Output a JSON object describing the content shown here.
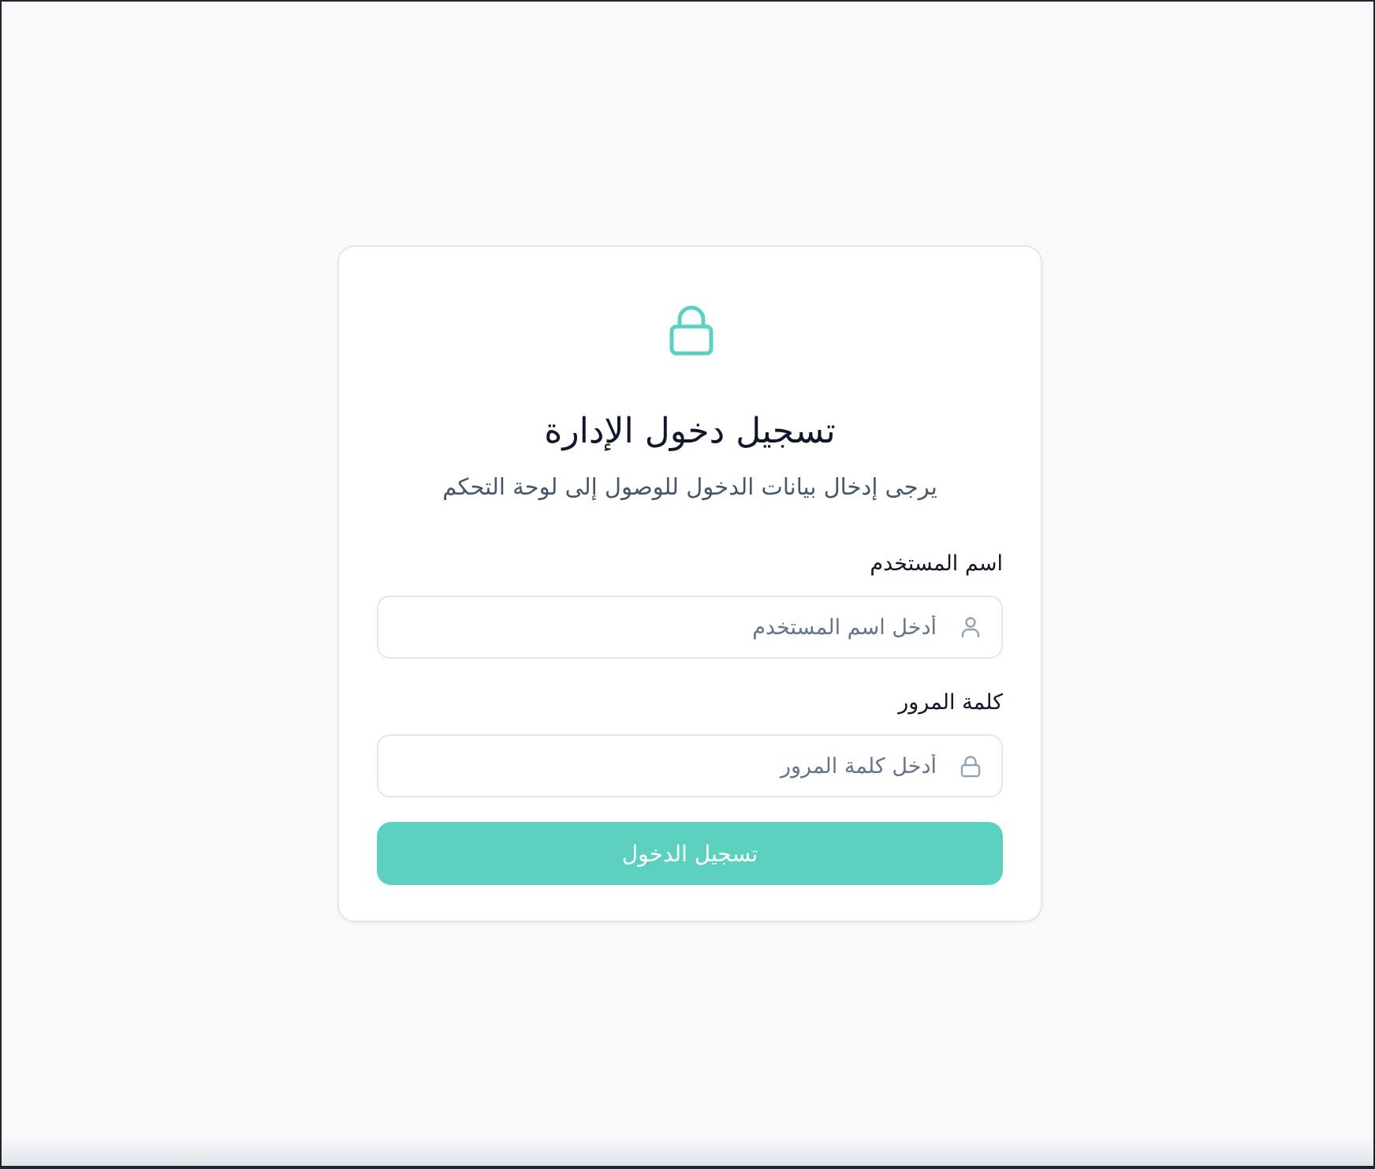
{
  "login": {
    "title": "تسجيل دخول الإدارة",
    "subtitle": "يرجى إدخال بيانات الدخول للوصول إلى لوحة التحكم",
    "username": {
      "label": "اسم المستخدم",
      "placeholder": "أدخل اسم المستخدم",
      "value": ""
    },
    "password": {
      "label": "كلمة المرور",
      "placeholder": "أدخل كلمة المرور",
      "value": ""
    },
    "submit_label": "تسجيل الدخول"
  },
  "icons": {
    "hero": "lock-icon",
    "username": "user-icon",
    "password": "lock-icon"
  },
  "colors": {
    "accent": "#5dd1c0",
    "page_background": "#f8f9fb",
    "card_background": "#ffffff",
    "title": "#0f172a",
    "subtitle": "#475569",
    "placeholder": "#64748b",
    "input_border": "#e2e8f0",
    "input_icon": "#94a3b8"
  }
}
